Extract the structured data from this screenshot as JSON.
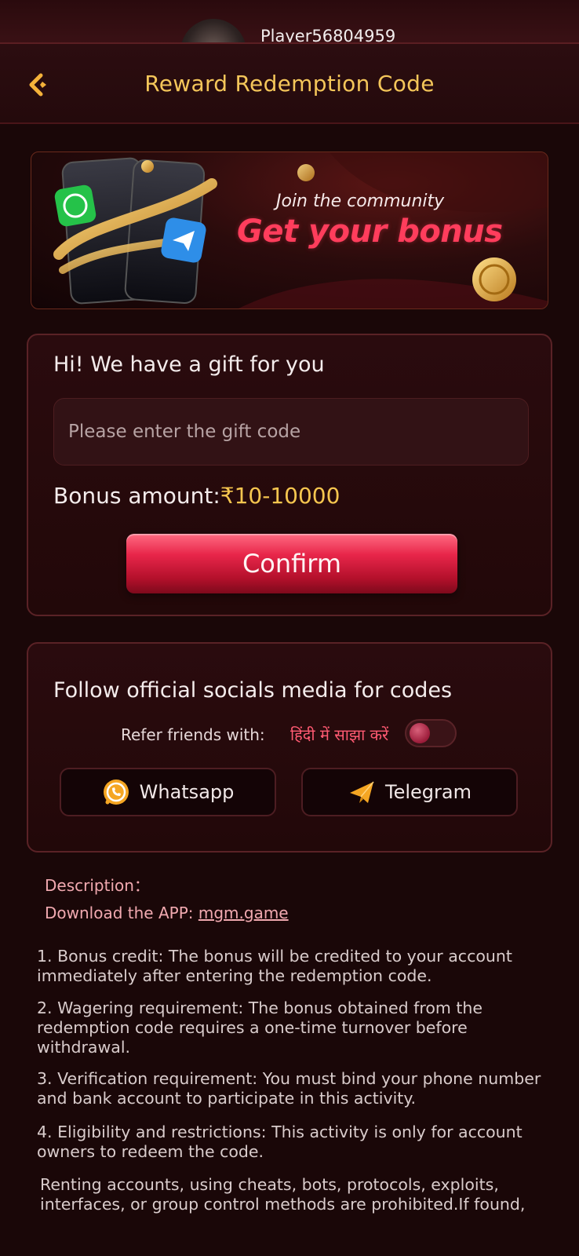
{
  "profile": {
    "player_name": "Player56804959"
  },
  "header": {
    "title": "Reward Redemption Code"
  },
  "banner": {
    "line1": "Join the community",
    "line2": "Get your bonus"
  },
  "gift": {
    "heading": "Hi! We have a gift for you",
    "input_placeholder": "Please enter the gift code",
    "bonus_label": "Bonus amount:",
    "bonus_value": "₹10-10000",
    "confirm_label": "Confirm"
  },
  "social": {
    "heading": "Follow official socials media for codes",
    "refer_label": "Refer friends with:",
    "hindi_share_label": "हिंदी में साझा करें",
    "hindi_toggle_on": false,
    "whatsapp_label": "Whatsapp",
    "telegram_label": "Telegram"
  },
  "description": {
    "title": "Description：",
    "download_prefix": "Download the APP: ",
    "download_link": "mgm.game",
    "rules": [
      "1. Bonus credit: The bonus will be credited to your account immediately after entering the redemption code.",
      "2. Wagering requirement: The bonus obtained from the redemption code requires a one-time turnover before withdrawal.",
      "3. Verification requirement: You must bind your phone number and bank account to participate in this activity.",
      "4. Eligibility and restrictions: This activity is only for account owners to redeem the code.",
      "Renting accounts, using cheats, bots, protocols, exploits, interfaces, or group control methods are prohibited.If found,"
    ]
  },
  "colors": {
    "background": "#1a0708",
    "title_gold": "#f4c65a",
    "accent_pink": "#ff3d5c",
    "confirm_red": "#e8264a",
    "description_pink": "#f1a9b0"
  },
  "icons": {
    "back": "chevron-left-icon",
    "whatsapp": "whatsapp-icon",
    "telegram": "telegram-plane-icon"
  }
}
